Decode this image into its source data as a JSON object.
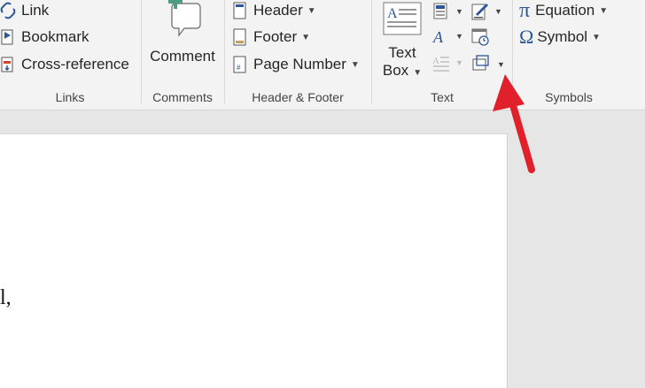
{
  "links_group": {
    "label": "Links",
    "items": [
      {
        "label": "Link"
      },
      {
        "label": "Bookmark"
      },
      {
        "label": "Cross-reference"
      }
    ]
  },
  "comments_group": {
    "label": "Comments",
    "comment_label": "Comment"
  },
  "header_footer_group": {
    "label": "Header & Footer",
    "items": [
      {
        "label": "Header"
      },
      {
        "label": "Footer"
      },
      {
        "label": "Page Number"
      }
    ]
  },
  "text_group": {
    "label": "Text",
    "text_box_line1": "Text",
    "text_box_line2": "Box"
  },
  "symbols_group": {
    "label": "Symbols",
    "items": [
      {
        "label": "Equation",
        "glyph": "π"
      },
      {
        "label": "Symbol",
        "glyph": "Ω"
      }
    ]
  },
  "document": {
    "visible_text": "l,"
  },
  "annotation": {
    "arrow_color": "#e0202a"
  },
  "colors": {
    "ribbon_bg": "#f3f3f3",
    "accent_blue": "#2b579a",
    "comment_green": "#4a9c82"
  }
}
